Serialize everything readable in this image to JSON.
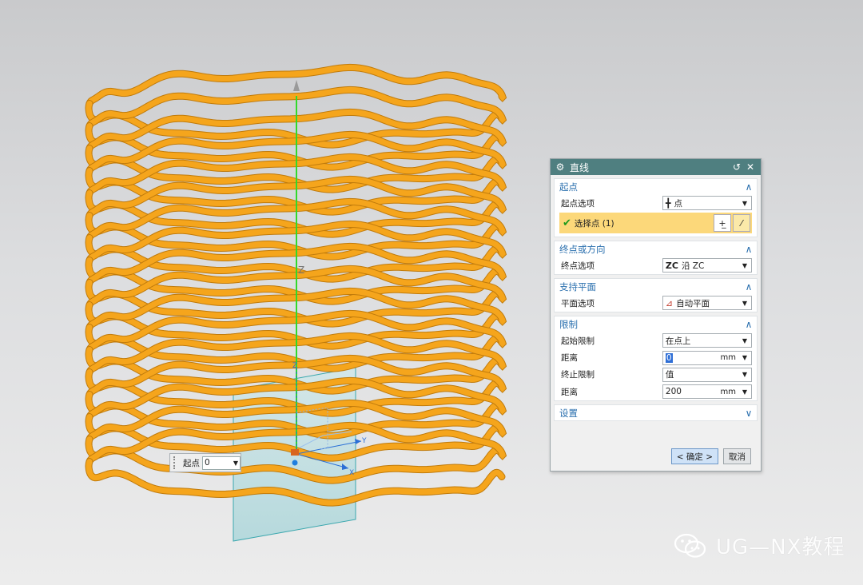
{
  "dialog": {
    "title": "直线",
    "icons": {
      "gear": "gear-icon",
      "reset": "reset-icon",
      "close": "close-icon"
    },
    "sections": {
      "start": {
        "header": "起点",
        "option_label": "起点选项",
        "option_value": "点",
        "option_icon": "plus-cross-icon",
        "select_label": "选择点 (1)"
      },
      "end": {
        "header": "终点或方向",
        "option_label": "终点选项",
        "option_value_prefix": "ZC",
        "option_value": "沿 ZC"
      },
      "plane": {
        "header": "支持平面",
        "option_label": "平面选项",
        "option_value": "自动平面"
      },
      "limits": {
        "header": "限制",
        "start_limit_label": "起始限制",
        "start_limit_value": "在点上",
        "distance1_label": "距离",
        "distance1_value": "0",
        "distance1_unit": "mm",
        "end_limit_label": "终止限制",
        "end_limit_value": "值",
        "distance2_label": "距离",
        "distance2_value": "200",
        "distance2_unit": "mm"
      },
      "settings": {
        "header": "设置"
      }
    },
    "buttons": {
      "ok": "< 确定 >",
      "cancel": "取消"
    }
  },
  "viewport": {
    "start_widget_label": "起点",
    "start_widget_value": "0",
    "axis_label_z": "Z",
    "axis_label_y": "Y",
    "axis_label_x": "X",
    "colors": {
      "spring": "#f5a51c",
      "axis": "#3cdc2a",
      "plane": "#bfe3e6"
    }
  },
  "watermark": {
    "text": "UG—NX教程"
  }
}
